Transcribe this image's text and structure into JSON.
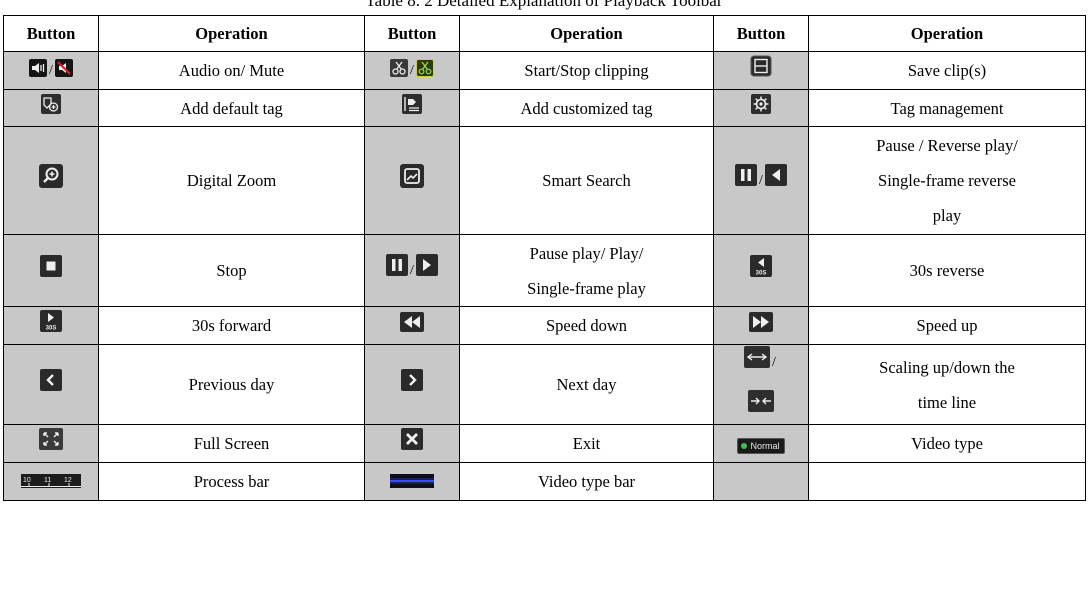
{
  "caption": "Table 8. 2 Detailed Explanation of Playback Toolbar",
  "headers": [
    "Button",
    "Operation",
    "Button",
    "Operation",
    "Button",
    "Operation"
  ],
  "rows": [
    {
      "op1": "Audio on/ Mute",
      "op2": "Start/Stop clipping",
      "op3": "Save clip(s)"
    },
    {
      "op1": "Add default tag",
      "op2": "Add customized tag",
      "op3": "Tag management"
    },
    {
      "op1": "Digital Zoom",
      "op2": "Smart Search",
      "op3_lines": [
        "Pause / Reverse play/",
        "Single-frame reverse",
        "play"
      ]
    },
    {
      "op1": "Stop",
      "op2_lines": [
        "Pause play/ Play/",
        "Single-frame play"
      ],
      "op3": "30s reverse"
    },
    {
      "op1": "30s forward",
      "op2": "Speed down",
      "op3": "Speed up"
    },
    {
      "op1": "Previous day",
      "op2": "Next day",
      "op3_lines": [
        "Scaling up/down the",
        "time line"
      ]
    },
    {
      "op1": "Full Screen",
      "op2": "Exit",
      "op3": "Video type"
    },
    {
      "op1": "Process bar",
      "op2": "Video type bar",
      "op3": ""
    }
  ],
  "icons": {
    "slash": "/",
    "thirty_label": "30S",
    "normal_label": "Normal",
    "ticks": [
      "10",
      "11",
      "12"
    ]
  }
}
